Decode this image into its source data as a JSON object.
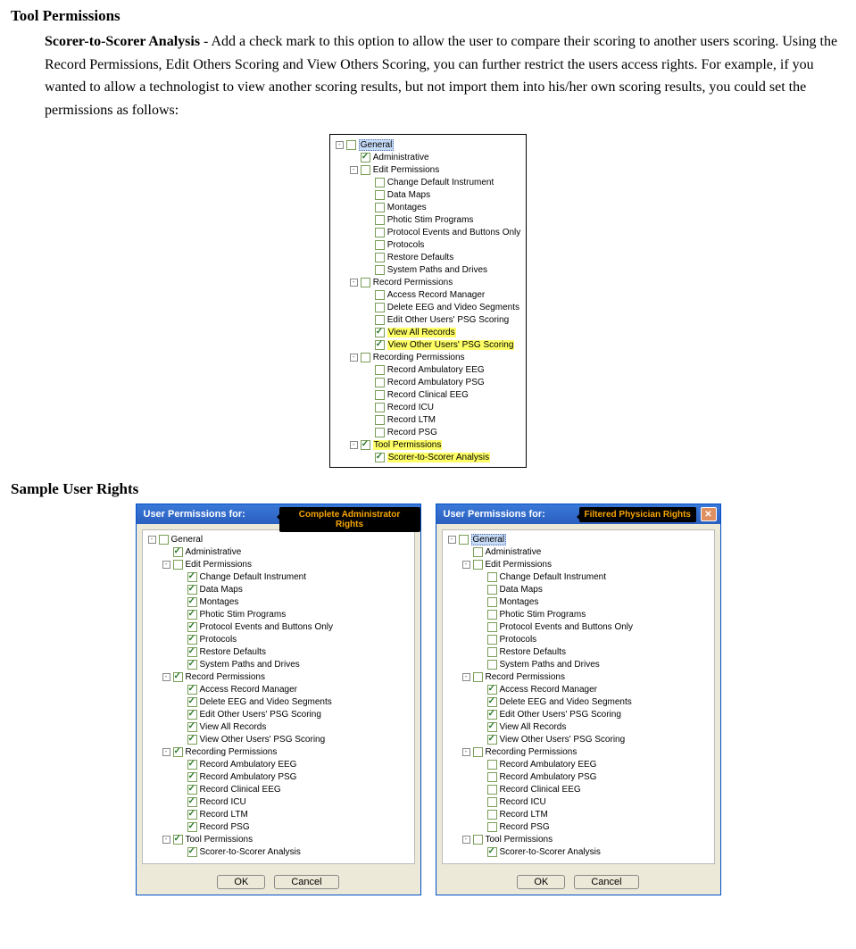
{
  "headings": {
    "tool_permissions": "Tool Permissions",
    "sample_user_rights": "Sample User Rights"
  },
  "paragraph": {
    "bold_lead": "Scorer-to-Scorer Analysis",
    "text": " - Add a check mark to this option to allow the user to compare their scoring to another users scoring.  Using the Record Permissions, Edit Others Scoring and View Others Scoring, you can further restrict the users access rights.  For example, if you wanted to allow a technologist to view another scoring results, but not import them into his/her own scoring results, you could set the permissions as follows:"
  },
  "tree_labels": {
    "general": "General",
    "administrative": "Administrative",
    "edit_permissions": "Edit Permissions",
    "change_default_instrument": "Change Default Instrument",
    "data_maps": "Data Maps",
    "montages": "Montages",
    "photic_stim_programs": "Photic Stim Programs",
    "protocol_events_buttons": "Protocol Events and Buttons Only",
    "protocols": "Protocols",
    "restore_defaults": "Restore Defaults",
    "system_paths_drives": "System Paths and Drives",
    "record_permissions": "Record Permissions",
    "access_record_manager": "Access Record Manager",
    "delete_eeg_video": "Delete EEG and Video Segments",
    "edit_other_psg": "Edit Other Users' PSG Scoring",
    "view_all_records": "View All Records",
    "view_other_psg": "View Other Users' PSG Scoring",
    "recording_permissions": "Recording Permissions",
    "record_ambulatory_eeg": "Record Ambulatory EEG",
    "record_ambulatory_psg": "Record Ambulatory PSG",
    "record_clinical_eeg": "Record Clinical EEG",
    "record_icu": "Record ICU",
    "record_ltm": "Record LTM",
    "record_psg": "Record PSG",
    "tool_permissions": "Tool Permissions",
    "scorer_to_scorer": "Scorer-to-Scorer Analysis"
  },
  "dialogs": {
    "title": "User Permissions for:",
    "left_callout": "Complete Administrator Rights",
    "right_callout": "Filtered Physician Rights",
    "ok": "OK",
    "cancel": "Cancel"
  },
  "tree_top": [
    {
      "ind": 0,
      "exp": "-",
      "chk": false,
      "key": "general",
      "sel": true
    },
    {
      "ind": 1,
      "exp": "",
      "chk": true,
      "key": "administrative"
    },
    {
      "ind": 1,
      "exp": "-",
      "chk": false,
      "key": "edit_permissions"
    },
    {
      "ind": 2,
      "exp": "",
      "chk": false,
      "key": "change_default_instrument"
    },
    {
      "ind": 2,
      "exp": "",
      "chk": false,
      "key": "data_maps"
    },
    {
      "ind": 2,
      "exp": "",
      "chk": false,
      "key": "montages"
    },
    {
      "ind": 2,
      "exp": "",
      "chk": false,
      "key": "photic_stim_programs"
    },
    {
      "ind": 2,
      "exp": "",
      "chk": false,
      "key": "protocol_events_buttons"
    },
    {
      "ind": 2,
      "exp": "",
      "chk": false,
      "key": "protocols"
    },
    {
      "ind": 2,
      "exp": "",
      "chk": false,
      "key": "restore_defaults"
    },
    {
      "ind": 2,
      "exp": "",
      "chk": false,
      "key": "system_paths_drives"
    },
    {
      "ind": 1,
      "exp": "-",
      "chk": false,
      "key": "record_permissions"
    },
    {
      "ind": 2,
      "exp": "",
      "chk": false,
      "key": "access_record_manager"
    },
    {
      "ind": 2,
      "exp": "",
      "chk": false,
      "key": "delete_eeg_video"
    },
    {
      "ind": 2,
      "exp": "",
      "chk": false,
      "key": "edit_other_psg"
    },
    {
      "ind": 2,
      "exp": "",
      "chk": true,
      "key": "view_all_records",
      "hl": true
    },
    {
      "ind": 2,
      "exp": "",
      "chk": true,
      "key": "view_other_psg",
      "hl": true
    },
    {
      "ind": 1,
      "exp": "-",
      "chk": false,
      "key": "recording_permissions"
    },
    {
      "ind": 2,
      "exp": "",
      "chk": false,
      "key": "record_ambulatory_eeg"
    },
    {
      "ind": 2,
      "exp": "",
      "chk": false,
      "key": "record_ambulatory_psg"
    },
    {
      "ind": 2,
      "exp": "",
      "chk": false,
      "key": "record_clinical_eeg"
    },
    {
      "ind": 2,
      "exp": "",
      "chk": false,
      "key": "record_icu"
    },
    {
      "ind": 2,
      "exp": "",
      "chk": false,
      "key": "record_ltm"
    },
    {
      "ind": 2,
      "exp": "",
      "chk": false,
      "key": "record_psg"
    },
    {
      "ind": 1,
      "exp": "-",
      "chk": true,
      "key": "tool_permissions",
      "hl": true
    },
    {
      "ind": 2,
      "exp": "",
      "chk": true,
      "key": "scorer_to_scorer",
      "hl": true
    }
  ],
  "tree_left": [
    {
      "ind": 0,
      "exp": "-",
      "chk": false,
      "key": "general"
    },
    {
      "ind": 1,
      "exp": "",
      "chk": true,
      "key": "administrative"
    },
    {
      "ind": 1,
      "exp": "-",
      "chk": false,
      "key": "edit_permissions"
    },
    {
      "ind": 2,
      "exp": "",
      "chk": true,
      "key": "change_default_instrument"
    },
    {
      "ind": 2,
      "exp": "",
      "chk": true,
      "key": "data_maps"
    },
    {
      "ind": 2,
      "exp": "",
      "chk": true,
      "key": "montages"
    },
    {
      "ind": 2,
      "exp": "",
      "chk": true,
      "key": "photic_stim_programs"
    },
    {
      "ind": 2,
      "exp": "",
      "chk": true,
      "key": "protocol_events_buttons"
    },
    {
      "ind": 2,
      "exp": "",
      "chk": true,
      "key": "protocols"
    },
    {
      "ind": 2,
      "exp": "",
      "chk": true,
      "key": "restore_defaults"
    },
    {
      "ind": 2,
      "exp": "",
      "chk": true,
      "key": "system_paths_drives"
    },
    {
      "ind": 1,
      "exp": "-",
      "chk": true,
      "key": "record_permissions"
    },
    {
      "ind": 2,
      "exp": "",
      "chk": true,
      "key": "access_record_manager"
    },
    {
      "ind": 2,
      "exp": "",
      "chk": true,
      "key": "delete_eeg_video"
    },
    {
      "ind": 2,
      "exp": "",
      "chk": true,
      "key": "edit_other_psg"
    },
    {
      "ind": 2,
      "exp": "",
      "chk": true,
      "key": "view_all_records"
    },
    {
      "ind": 2,
      "exp": "",
      "chk": true,
      "key": "view_other_psg"
    },
    {
      "ind": 1,
      "exp": "-",
      "chk": true,
      "key": "recording_permissions"
    },
    {
      "ind": 2,
      "exp": "",
      "chk": true,
      "key": "record_ambulatory_eeg"
    },
    {
      "ind": 2,
      "exp": "",
      "chk": true,
      "key": "record_ambulatory_psg"
    },
    {
      "ind": 2,
      "exp": "",
      "chk": true,
      "key": "record_clinical_eeg"
    },
    {
      "ind": 2,
      "exp": "",
      "chk": true,
      "key": "record_icu"
    },
    {
      "ind": 2,
      "exp": "",
      "chk": true,
      "key": "record_ltm"
    },
    {
      "ind": 2,
      "exp": "",
      "chk": true,
      "key": "record_psg"
    },
    {
      "ind": 1,
      "exp": "-",
      "chk": true,
      "key": "tool_permissions"
    },
    {
      "ind": 2,
      "exp": "",
      "chk": true,
      "key": "scorer_to_scorer"
    }
  ],
  "tree_right": [
    {
      "ind": 0,
      "exp": "-",
      "chk": false,
      "key": "general",
      "sel": true
    },
    {
      "ind": 1,
      "exp": "",
      "chk": false,
      "key": "administrative"
    },
    {
      "ind": 1,
      "exp": "-",
      "chk": false,
      "key": "edit_permissions"
    },
    {
      "ind": 2,
      "exp": "",
      "chk": false,
      "key": "change_default_instrument"
    },
    {
      "ind": 2,
      "exp": "",
      "chk": false,
      "key": "data_maps"
    },
    {
      "ind": 2,
      "exp": "",
      "chk": false,
      "key": "montages"
    },
    {
      "ind": 2,
      "exp": "",
      "chk": false,
      "key": "photic_stim_programs"
    },
    {
      "ind": 2,
      "exp": "",
      "chk": false,
      "key": "protocol_events_buttons"
    },
    {
      "ind": 2,
      "exp": "",
      "chk": false,
      "key": "protocols"
    },
    {
      "ind": 2,
      "exp": "",
      "chk": false,
      "key": "restore_defaults"
    },
    {
      "ind": 2,
      "exp": "",
      "chk": false,
      "key": "system_paths_drives"
    },
    {
      "ind": 1,
      "exp": "-",
      "chk": false,
      "key": "record_permissions"
    },
    {
      "ind": 2,
      "exp": "",
      "chk": true,
      "key": "access_record_manager"
    },
    {
      "ind": 2,
      "exp": "",
      "chk": true,
      "key": "delete_eeg_video"
    },
    {
      "ind": 2,
      "exp": "",
      "chk": true,
      "key": "edit_other_psg"
    },
    {
      "ind": 2,
      "exp": "",
      "chk": true,
      "key": "view_all_records"
    },
    {
      "ind": 2,
      "exp": "",
      "chk": true,
      "key": "view_other_psg"
    },
    {
      "ind": 1,
      "exp": "-",
      "chk": false,
      "key": "recording_permissions"
    },
    {
      "ind": 2,
      "exp": "",
      "chk": false,
      "key": "record_ambulatory_eeg"
    },
    {
      "ind": 2,
      "exp": "",
      "chk": false,
      "key": "record_ambulatory_psg"
    },
    {
      "ind": 2,
      "exp": "",
      "chk": false,
      "key": "record_clinical_eeg"
    },
    {
      "ind": 2,
      "exp": "",
      "chk": false,
      "key": "record_icu"
    },
    {
      "ind": 2,
      "exp": "",
      "chk": false,
      "key": "record_ltm"
    },
    {
      "ind": 2,
      "exp": "",
      "chk": false,
      "key": "record_psg"
    },
    {
      "ind": 1,
      "exp": "-",
      "chk": false,
      "key": "tool_permissions"
    },
    {
      "ind": 2,
      "exp": "",
      "chk": true,
      "key": "scorer_to_scorer"
    }
  ]
}
